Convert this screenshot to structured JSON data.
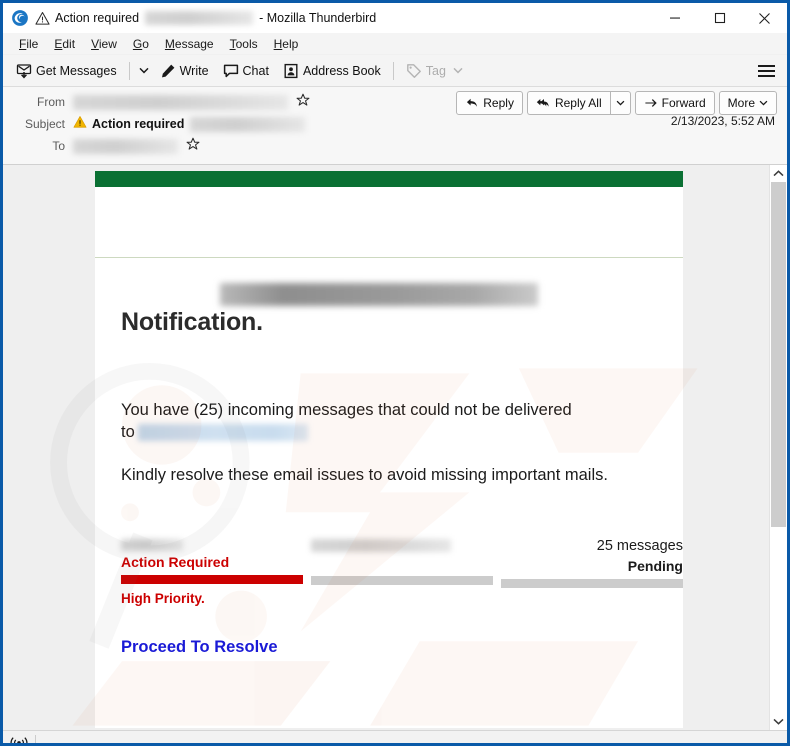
{
  "window": {
    "title_prefix": "Action required",
    "title_suffix": "- Mozilla Thunderbird",
    "app_icon": "thunderbird-icon",
    "warning_icon": "warning-triangle-icon",
    "minimize_label": "─",
    "maximize_label": "□",
    "close_label": "✕"
  },
  "menubar": {
    "items": [
      {
        "label": "File",
        "accel": "F",
        "rest": "ile"
      },
      {
        "label": "Edit",
        "accel": "E",
        "rest": "dit"
      },
      {
        "label": "View",
        "accel": "V",
        "rest": "iew"
      },
      {
        "label": "Go",
        "accel": "G",
        "rest": "o"
      },
      {
        "label": "Message",
        "accel": "M",
        "rest": "essage"
      },
      {
        "label": "Tools",
        "accel": "T",
        "rest": "ools"
      },
      {
        "label": "Help",
        "accel": "H",
        "rest": "elp"
      }
    ]
  },
  "toolbar": {
    "get_messages": "Get Messages",
    "write": "Write",
    "chat": "Chat",
    "address_book": "Address Book",
    "tag": "Tag",
    "tag_disabled": true,
    "menu_icon": "hamburger-menu-icon"
  },
  "message_header": {
    "from_label": "From",
    "from_value_redacted": true,
    "subject_label": "Subject",
    "subject_value": "Action required",
    "subject_value_redacted": true,
    "to_label": "To",
    "to_value_redacted": true,
    "date": "2/13/2023, 5:52 AM",
    "actions": {
      "reply": "Reply",
      "reply_all": "Reply All",
      "forward": "Forward",
      "more": "More"
    }
  },
  "email": {
    "accent_green": "#0a7033",
    "rule_color": "#cdd9c0",
    "sender_address_redacted": true,
    "title": "Notification.",
    "paragraph_1_before": "You have (25) incoming messages that could not be delivered",
    "paragraph_1_to": "to",
    "paragraph_1_redacted": true,
    "paragraph_2": "Kindly resolve these email issues to avoid missing important mails.",
    "columns": [
      {
        "top_redacted": true,
        "label": "Action Required",
        "label_color": "#cc0000",
        "bar_color": "#cc0000",
        "bar_fill_percent": 100
      },
      {
        "top_redacted": true,
        "label": "",
        "bar_color": "#cccccc",
        "bar_fill_percent": 100
      },
      {
        "top_text": "25 messages",
        "label": "Pending",
        "label_color": "#1b1b1b",
        "bar_color": "#cccccc",
        "bar_fill_percent": 100
      }
    ],
    "priority_note": "High Priority.",
    "cta_label": "Proceed To Resolve",
    "cta_color": "#1a1ad6"
  },
  "statusbar": {
    "icon": "wireless-broadcast-icon"
  }
}
